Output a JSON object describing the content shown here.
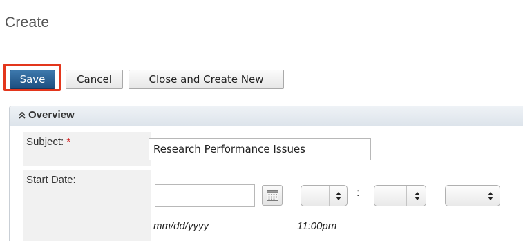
{
  "page": {
    "title": "Create"
  },
  "toolbar": {
    "save_label": "Save",
    "cancel_label": "Cancel",
    "close_create_new_label": "Close and Create New"
  },
  "panel": {
    "title": "Overview",
    "toggle_icon": "chevron-double-up-icon"
  },
  "fields": {
    "subject": {
      "label": "Subject:",
      "required_marker": "*",
      "value": "Research Performance Issues"
    },
    "start_date": {
      "label": "Start Date:",
      "date_value": "",
      "date_format_hint": "mm/dd/yyyy",
      "time_hint": "11:00pm",
      "calendar_icon": "calendar-icon",
      "time_separator": ":",
      "hour_value": "",
      "minute_value": "",
      "meridiem_value": ""
    }
  },
  "colors": {
    "save_button": "#1d4f80",
    "highlight_border": "#e3361c",
    "required_star": "#d11c1c",
    "label_background": "#f1f1f1"
  }
}
